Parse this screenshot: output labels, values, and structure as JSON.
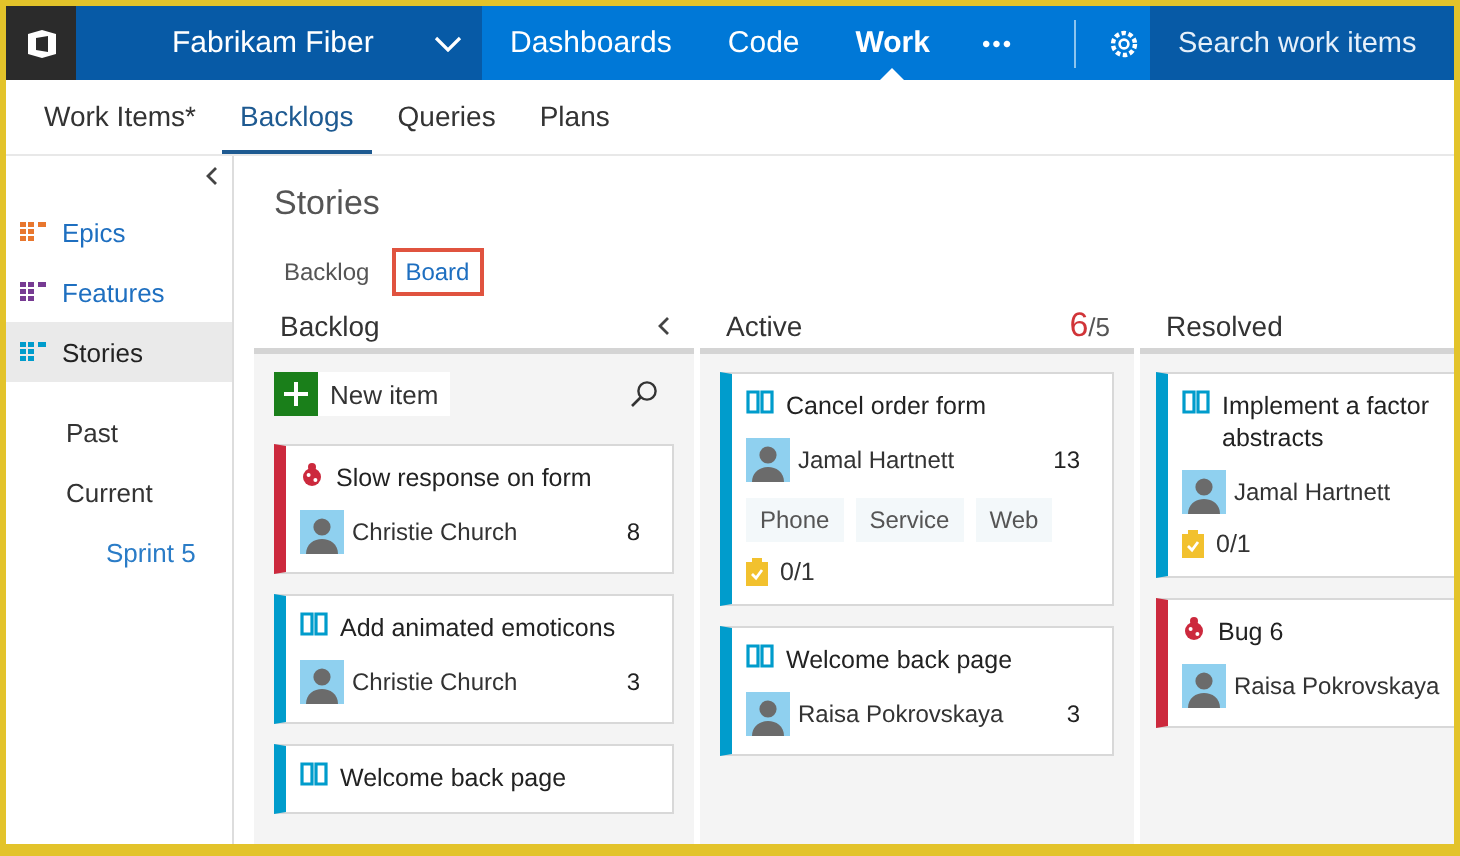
{
  "nav": {
    "project": "Fabrikam Fiber",
    "links": [
      {
        "label": "Dashboards",
        "selected": false
      },
      {
        "label": "Code",
        "selected": false
      },
      {
        "label": "Work",
        "selected": true
      }
    ],
    "more": "•••",
    "search": {
      "placeholder": "Search work items"
    }
  },
  "subnav": [
    {
      "label": "Work Items*",
      "selected": false
    },
    {
      "label": "Backlogs",
      "selected": true
    },
    {
      "label": "Queries",
      "selected": false
    },
    {
      "label": "Plans",
      "selected": false
    }
  ],
  "sidebar": {
    "levels": [
      {
        "label": "Epics",
        "selected": false,
        "color": "#e8772e"
      },
      {
        "label": "Features",
        "selected": false,
        "color": "#773b93"
      },
      {
        "label": "Stories",
        "selected": true,
        "color": "#009ccc"
      }
    ],
    "iterations": [
      {
        "label": "Past",
        "selected": false
      },
      {
        "label": "Current",
        "selected": false,
        "children": [
          {
            "label": "Sprint 5",
            "selected": false
          }
        ]
      }
    ]
  },
  "page_title": "Stories",
  "views": [
    {
      "label": "Backlog",
      "selected": false
    },
    {
      "label": "Board",
      "selected": true
    }
  ],
  "columns": [
    {
      "name": "Backlog",
      "new_item": "New item",
      "cards": [
        {
          "kind": "bug",
          "title": [
            "Slow response on form"
          ],
          "assignee": "Christie Church",
          "effort": "8"
        },
        {
          "kind": "story",
          "title": [
            "Add animated emoticons"
          ],
          "assignee": "Christie Church",
          "effort": "3"
        },
        {
          "kind": "story",
          "title": [
            "Welcome back page"
          ]
        }
      ]
    },
    {
      "name": "Active",
      "wip_count": "6",
      "wip_limit": "/5",
      "cards": [
        {
          "kind": "story",
          "title": [
            "Cancel order form"
          ],
          "assignee": "Jamal Hartnett",
          "effort": "13",
          "tags": [
            "Phone",
            "Service",
            "Web"
          ],
          "tasks": "0/1"
        },
        {
          "kind": "story",
          "title": [
            "Welcome back page"
          ],
          "assignee": "Raisa Pokrovskaya",
          "effort": "3"
        }
      ]
    },
    {
      "name": "Resolved",
      "cards": [
        {
          "kind": "story",
          "title": [
            "Implement a factor",
            "abstracts"
          ],
          "assignee": "Jamal Hartnett",
          "tasks": "0/1"
        },
        {
          "kind": "bug",
          "title": [
            "Bug 6"
          ],
          "assignee": "Raisa Pokrovskaya"
        }
      ]
    }
  ]
}
